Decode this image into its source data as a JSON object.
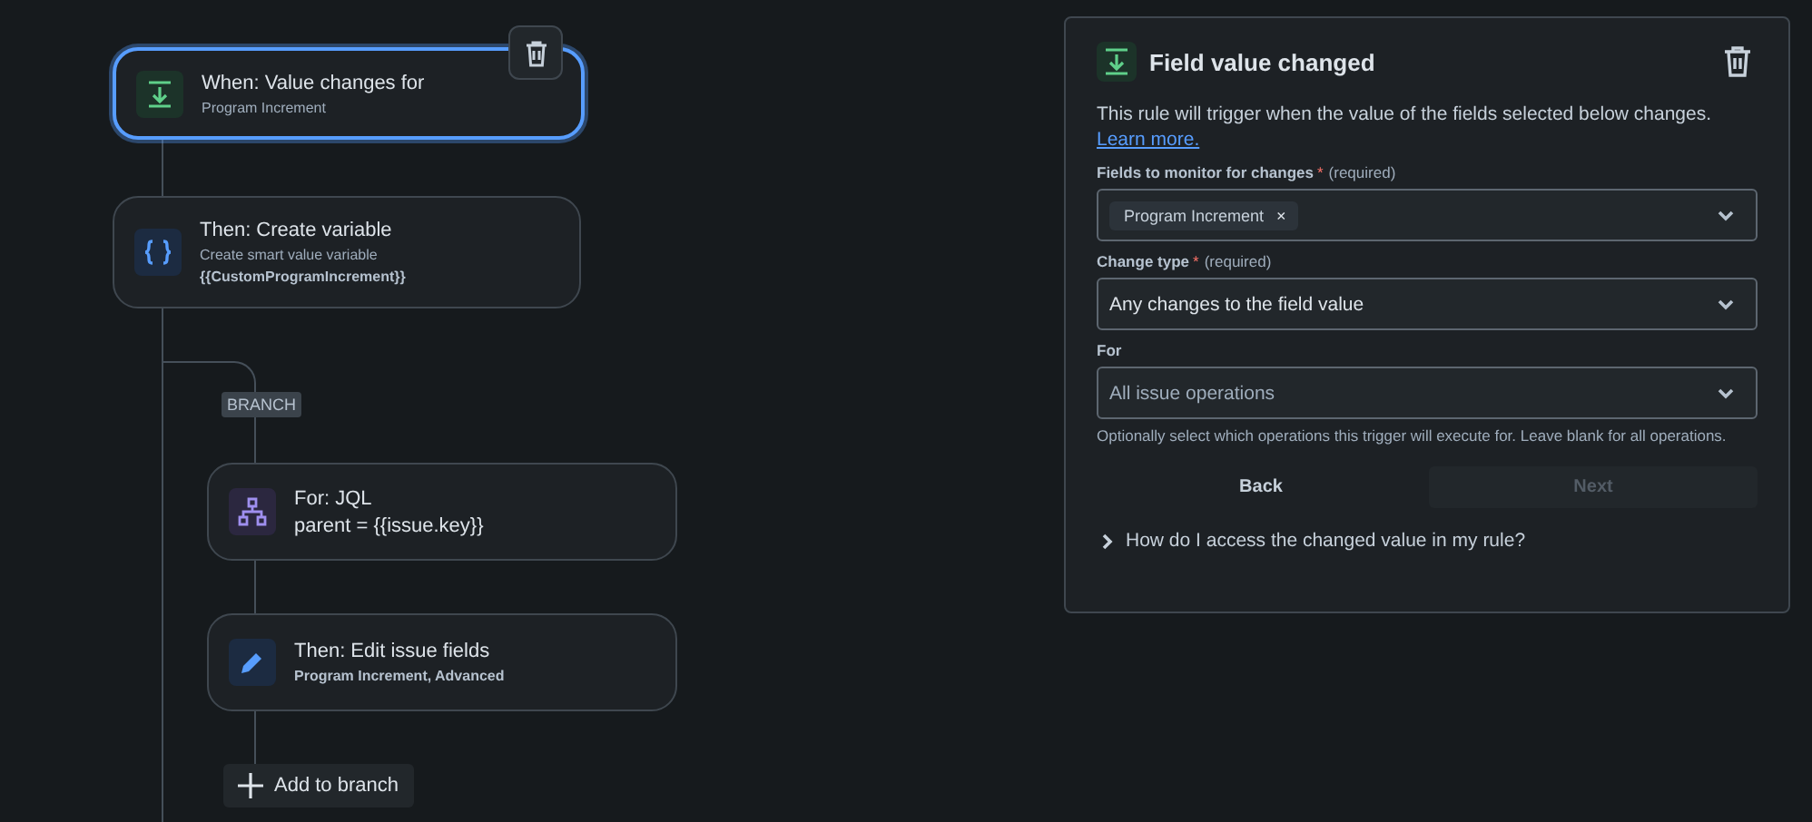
{
  "canvas": {
    "delete_button": {
      "kind": "trash"
    },
    "nodes": [
      {
        "kind": "trigger",
        "title": "When: Value changes for",
        "subtitle": "Program Increment",
        "selected": true
      },
      {
        "kind": "variable",
        "title": "Then: Create variable",
        "subtitle": "Create smart value variable",
        "detail": "{{CustomProgramIncrement}}",
        "selected": false
      },
      {
        "kind": "branch",
        "title": "For: JQL",
        "subtitle": "parent = {{issue.key}}",
        "selected": false
      },
      {
        "kind": "action",
        "title": "Then: Edit issue fields",
        "detail": "Program Increment, Advanced",
        "selected": false
      }
    ],
    "branch_label": "BRANCH",
    "add_button": "Add to branch"
  },
  "panel": {
    "title": "Field value changed",
    "description": "This rule will trigger when the value of the fields selected below changes.",
    "link": "Learn more.",
    "fields": [
      {
        "kind": "multi",
        "label": "Fields to monitor for changes",
        "required_mark": "*",
        "required_note": "(required)",
        "tags": [
          {
            "label": "Program Increment",
            "remove": "×"
          }
        ]
      },
      {
        "kind": "select",
        "label": "Change type",
        "required_mark": "*",
        "required_note": "(required)",
        "value": "Any changes to the field value"
      },
      {
        "kind": "select",
        "label": "For",
        "placeholder": "All issue operations",
        "help": "Optionally select which operations this trigger will execute for. Leave blank for all operations."
      }
    ],
    "buttons": [
      {
        "label": "Back",
        "disabled": false
      },
      {
        "label": "Next",
        "disabled": true
      }
    ],
    "disclosure": {
      "label": "How do I access the changed value in my rule?",
      "expanded": false
    }
  }
}
